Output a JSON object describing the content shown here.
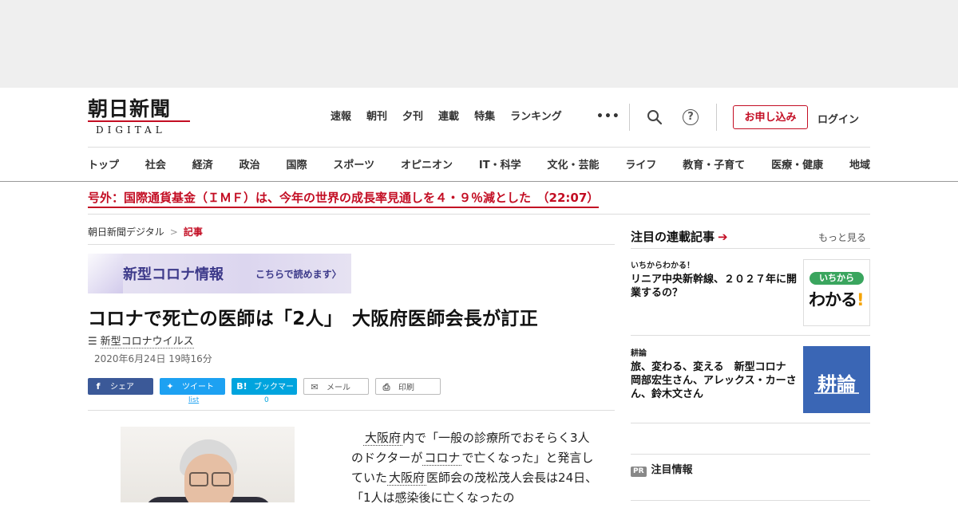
{
  "header": {
    "logo_main": "朝日新聞",
    "logo_sub": "DIGITAL",
    "top_nav": [
      "速報",
      "朝刊",
      "夕刊",
      "連載",
      "特集",
      "ランキング"
    ],
    "more_label": "•••",
    "help_label": "?",
    "subscribe_label": "お申し込み",
    "login_label": "ログイン",
    "categories": [
      "トップ",
      "社会",
      "経済",
      "政治",
      "国際",
      "スポーツ",
      "オピニオン",
      "IT・科学",
      "文化・芸能",
      "ライフ",
      "教育・子育て",
      "医療・健康",
      "地域"
    ]
  },
  "breaking": {
    "text": "号外：国際通貨基金（ＩＭＦ）は、今年の世界の成長率見通しを４・９％減とした　（22:07）"
  },
  "breadcrumb": {
    "home": "朝日新聞デジタル",
    "sep": ">",
    "current": "記事"
  },
  "banner": {
    "title": "新型コロナ情報",
    "link": "こちらで読めます〉"
  },
  "article": {
    "headline": "コロナで死亡の医師は「2人」　大阪府医師会長が訂正",
    "topic": "新型コロナウイルス",
    "date": "2020年6月24日 19時16分",
    "share": {
      "facebook": "シェア",
      "twitter": "ツイート",
      "twitter_count": "list",
      "hatena": "ブックマーク",
      "hatena_count": "0",
      "mail": "メール",
      "print": "印刷"
    },
    "body": {
      "kw1": "大阪府",
      "t1": "内で「一般の診療所でおそらく3人のドクターが",
      "kw2": "コロナ",
      "t2": "で亡くなった」と発言していた",
      "kw3": "大阪府",
      "t3": "医師会の茂松茂人会長は24日、「1人は感染後に亡くなったの"
    }
  },
  "sidebar": {
    "heading": "注目の連載記事",
    "arrow": "➔",
    "more": "もっと見る",
    "items": [
      {
        "kicker": "いちからわかる！",
        "title": "リニア中央新幹線、２０２７年に開業するの？",
        "thumb_pill": "いちから",
        "thumb_big": "わかる",
        "thumb_bang": "!"
      },
      {
        "kicker": "耕論",
        "title": "旅、変わる、変える　新型コロナ　岡部宏生さん、アレックス・カーさん、鈴木文さん",
        "thumb_text": "耕論"
      }
    ],
    "pr_badge": "PR",
    "pr_label": "注目情報"
  }
}
